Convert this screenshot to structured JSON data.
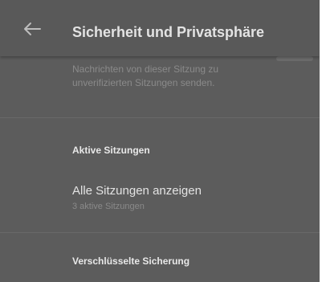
{
  "header": {
    "title": "Sicherheit und Privatsphäre",
    "back_icon": "arrow-back-icon"
  },
  "unverified_sessions": {
    "description": "Nachrichten von dieser Sitzung zu unverifizierten Sitzungen senden.",
    "toggle_on": false
  },
  "active_sessions": {
    "section_title": "Aktive Sitzungen",
    "show_all_label": "Alle Sitzungen anzeigen",
    "count_text": "3 aktive Sitzungen"
  },
  "backup": {
    "section_title": "Verschlüsselte Sicherung"
  },
  "colors": {
    "overlay": "#5c5c5c",
    "text_primary": "#e3e3e3",
    "text_secondary": "#8a8a8a"
  }
}
